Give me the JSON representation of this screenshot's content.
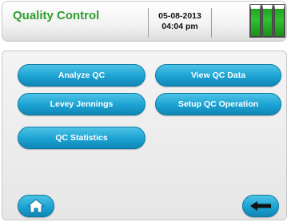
{
  "header": {
    "title": "Quality Control",
    "date": "05-08-2013",
    "time": "04:04 pm",
    "battery": {
      "icon": "battery-icon",
      "level": 1.0,
      "color": "#2fc22f"
    }
  },
  "menu": {
    "analyze_qc": "Analyze QC",
    "view_qc_data": "View QC Data",
    "levey_jennings": "Levey Jennings",
    "setup_qc_operation": "Setup QC Operation",
    "qc_statistics": "QC Statistics"
  },
  "footer": {
    "home_icon": "home-icon",
    "back_icon": "back-arrow-icon"
  },
  "colors": {
    "accent": "#1ba2d2",
    "title": "#2e9e2e"
  }
}
